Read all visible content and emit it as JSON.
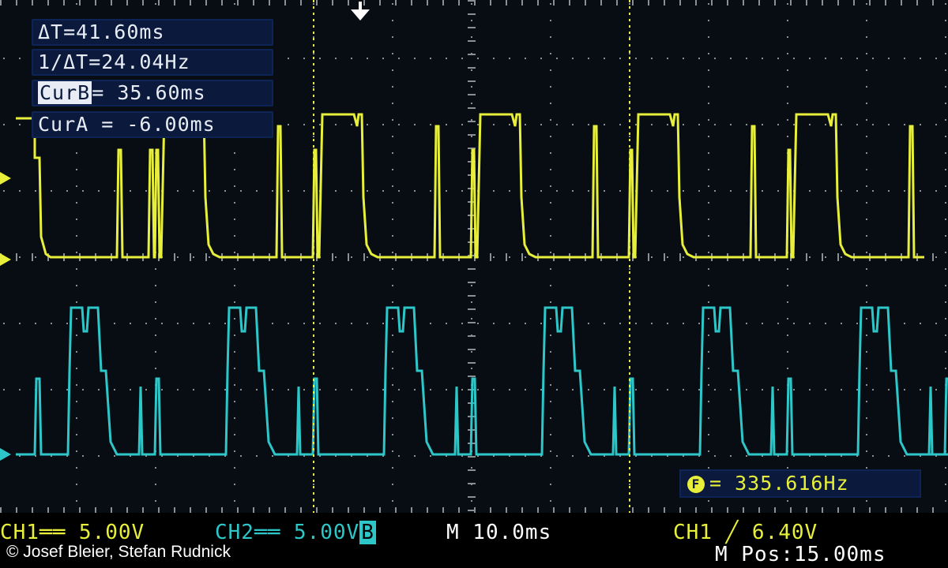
{
  "readouts": {
    "delta_t": "ΔT=41.60ms",
    "inv_delta_t": "1/ΔT=24.04Hz",
    "cur_b_label": "CurB",
    "cur_b_value": "= 35.60ms",
    "cur_a": "CurA = -6.00ms"
  },
  "frequency": {
    "icon": "F",
    "text": "= 335.616Hz"
  },
  "status": {
    "ch1": "CH1══ 5.00V",
    "ch2_label": "CH2══ 5.00V",
    "ch2_bw": "B",
    "timebase": "M 10.0ms",
    "trigger": "CH1 ╱ 6.40V",
    "position": "M Pos:15.00ms"
  },
  "copyright": "© Josef Bleier, Stefan Rudnick",
  "colors": {
    "ch1": "#e7ef3a",
    "ch2": "#2ec7c9",
    "grid": "#8a8f96",
    "cursor": "#e7ef3a",
    "readout_bg": "#0b1a3c"
  },
  "markers": {
    "trigger_arrow_icon": "down-arrow-icon",
    "ch1_ground_marker_icon": "right-arrow-icon",
    "ch2_ground_marker_icon": "right-arrow-icon"
  }
}
